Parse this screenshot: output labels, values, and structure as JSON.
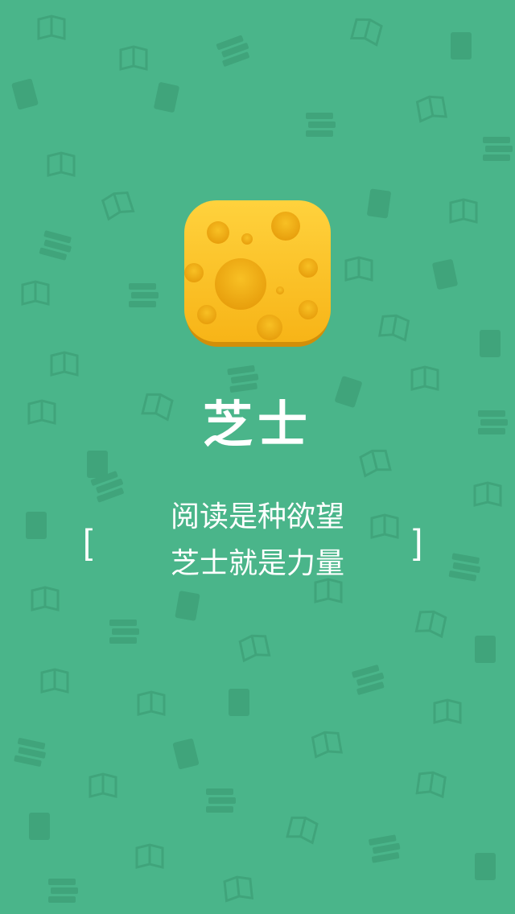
{
  "splash": {
    "app_name": "芝士",
    "slogan_line1": "阅读是种欲望",
    "slogan_line2": "芝士就是力量",
    "bracket_open": "[",
    "bracket_close": "]"
  },
  "icons": {
    "app_icon": "cheese-icon",
    "background_pattern": "book-icon"
  },
  "colors": {
    "background": "#4ab58a",
    "pattern": "#3fa37a",
    "cheese": "#fdc22b",
    "cheese_hole": "#f2ac13",
    "text": "#ffffff"
  }
}
